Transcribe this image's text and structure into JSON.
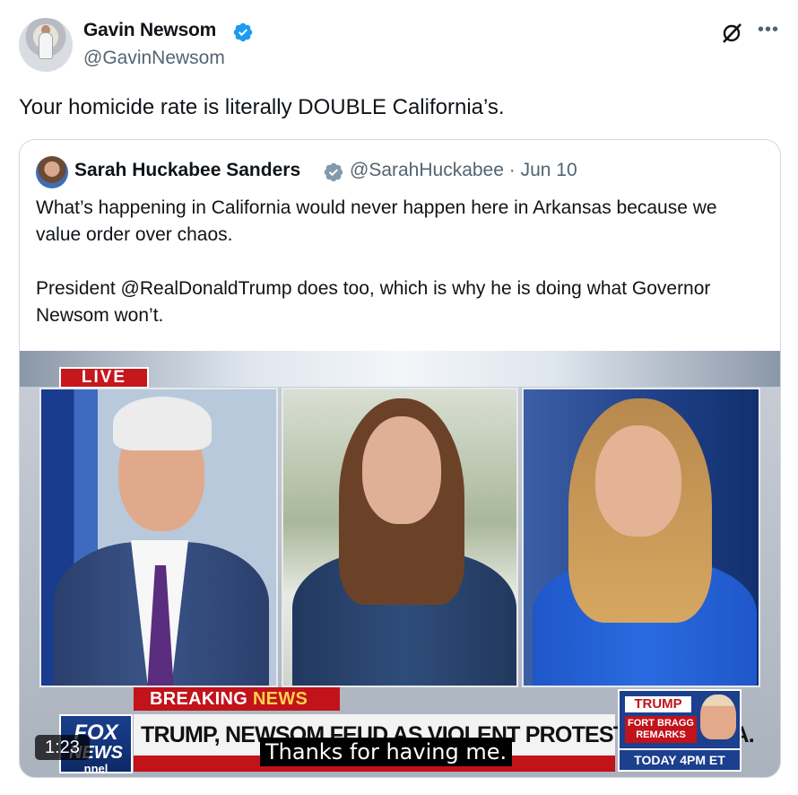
{
  "tweet": {
    "author_name": "Gavin Newsom",
    "handle": "@GavinNewsom",
    "text": "Your homicide rate is literally DOUBLE California’s.",
    "more_icon": "more-horizontal-icon",
    "grok_icon": "grok-icon",
    "verified_color": "#1d9bf0"
  },
  "quote": {
    "author_name": "Sarah Huckabee Sanders",
    "handle": "@SarahHuckabee",
    "date": "· Jun 10",
    "verified_color": "#829aab",
    "paragraph_1": "What’s happening in California would never happen here in Arkansas because we value order over chaos.",
    "paragraph_2": "President @RealDonaldTrump does too, which is why he is doing what Governor Newsom won’t."
  },
  "video": {
    "live_label": "LIVE",
    "breaking_label_1": "BREAKING ",
    "breaking_label_2": "NEWS",
    "network_logo_top": "FOX",
    "network_logo_mid": "NEWS",
    "network_logo_bottom": "nnel",
    "headline": "TRUMP, NEWSOM FEUD AS VIOLENT PROTESTS ROCK L.A.",
    "caption": "Thanks for having me.",
    "promo_name": "TRUMP",
    "promo_sub": "FORT BRAGG REMARKS",
    "promo_time": "TODAY 4PM ET",
    "duration": "1:23"
  }
}
